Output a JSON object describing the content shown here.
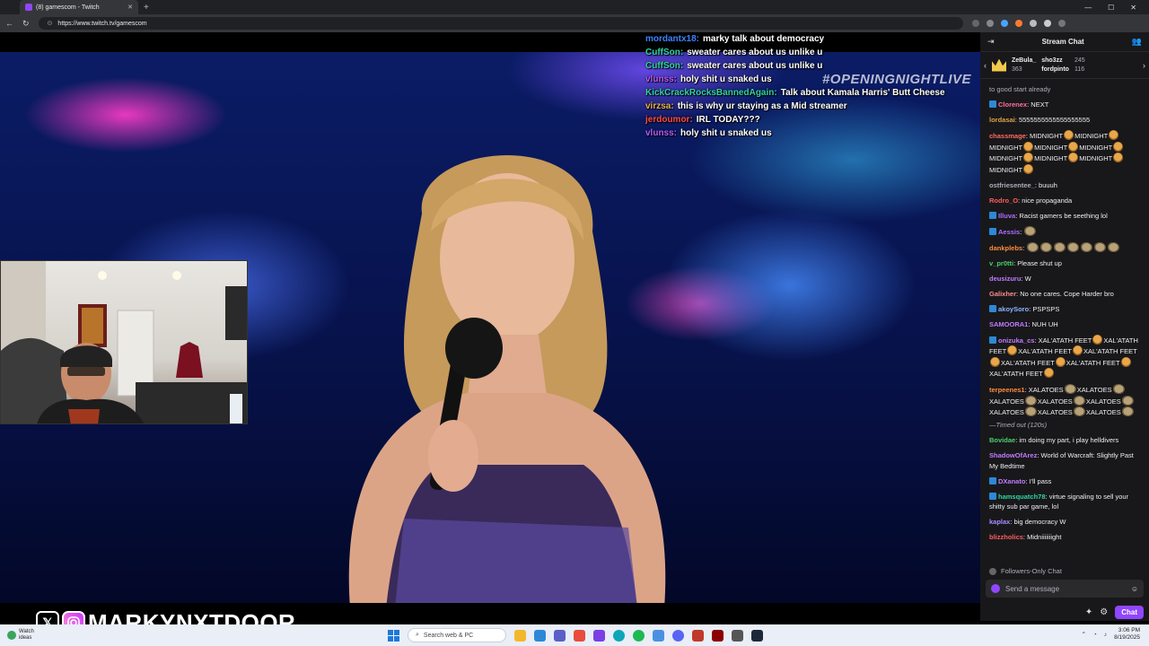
{
  "browser": {
    "tab_title": "(8) gamescom - Twitch",
    "url": "https://www.twitch.tv/gamescom"
  },
  "stream": {
    "hashtag": "#OPENINGNIGHTLIVE",
    "watermark": "MARKYNXTDOOR"
  },
  "overlay_chat": [
    {
      "user": "mordantx18:",
      "color": "#3b82ff",
      "text": "marky talk about democracy"
    },
    {
      "user": "CuffSon:",
      "color": "#2fd4a0",
      "text": "sweater cares about us unlike u"
    },
    {
      "user": "CuffSon:",
      "color": "#2fd4a0",
      "text": "sweater cares about us unlike u"
    },
    {
      "user": "vlunss:",
      "color": "#b45cff",
      "text": "holy shit u snaked us"
    },
    {
      "user": "KickCrackRocksBannedAgain:",
      "color": "#2fd4a0",
      "text": "Talk about Kamala Harris' Butt Cheese"
    },
    {
      "user": "virzsa:",
      "color": "#e8b04a",
      "text": "this is why ur staying as a Mid streamer"
    },
    {
      "user": "jerdoumor:",
      "color": "#ff4a4a",
      "text": "IRL TODAY???"
    },
    {
      "user": "vlunss:",
      "color": "#b45cff",
      "text": "holy shit u snaked us"
    }
  ],
  "chat": {
    "title": "Stream Chat",
    "leaderboard": [
      {
        "name": "ZeBula_",
        "count": "363"
      },
      {
        "name": "sho3zz",
        "count": "245"
      },
      {
        "name": "fordpinto",
        "count": "116"
      }
    ],
    "messages": [
      {
        "user": "",
        "color": "#adadb8",
        "text": "to good start already"
      },
      {
        "user": "Clorenex",
        "color": "#ff6f9c",
        "text": "NEXT",
        "badge": true
      },
      {
        "user": "lordasai",
        "color": "#e0a04a",
        "text": "5555555555555555555"
      },
      {
        "user": "chassmage",
        "color": "#ff6a5e",
        "text": "MIDNIGHT",
        "emotes": "midnight"
      },
      {
        "user": "ostfriesentee_",
        "color": "#adadb8",
        "text": "buuuh"
      },
      {
        "user": "Rodro_O",
        "color": "#ff5c5c",
        "text": "nice propaganda"
      },
      {
        "user": "Illuva",
        "color": "#b06cff",
        "text": "Racist gamers be seething lol",
        "badge": true
      },
      {
        "user": "Aessis",
        "color": "#b06cff",
        "text": "",
        "badge": true
      },
      {
        "user": "dankplebs",
        "color": "#ff8c3a",
        "text": "",
        "emotes": "beans"
      },
      {
        "user": "v_pr0tti",
        "color": "#4ad06a",
        "text": "Please shut up"
      },
      {
        "user": "deusizuru",
        "color": "#c07cff",
        "text": "W"
      },
      {
        "user": "Galixher",
        "color": "#ff8c8c",
        "text": "No one cares. Cope Harder bro"
      },
      {
        "user": "akoySoro",
        "color": "#8ab4ff",
        "text": "PSPSPS",
        "badge": true
      },
      {
        "user": "SAMOORA1",
        "color": "#c07cff",
        "text": "NUH UH"
      },
      {
        "user": "onizuka_cs",
        "color": "#c07cff",
        "text": "XAL'ATATH FEET",
        "emotes": "xal",
        "badge": true
      },
      {
        "user": "terpeenes1",
        "color": "#ff8c3a",
        "text": "XALATOES",
        "emotes": "xalatoes"
      },
      {
        "user": "Bovidae",
        "color": "#4ad06a",
        "text": "im doing my part, i play helldivers"
      },
      {
        "user": "ShadowOfArez",
        "color": "#c07cff",
        "text": "World of Warcraft: Slightly Past My Bedtime"
      },
      {
        "user": "DXanato",
        "color": "#c07cff",
        "text": "I'll pass",
        "badge": true
      },
      {
        "user": "hamsquatch78",
        "color": "#2fd4a0",
        "text": "virtue signaling to sell your shitty sub par game, lol",
        "badge": true
      },
      {
        "user": "kaplax",
        "color": "#a98cff",
        "text": "big democracy W"
      },
      {
        "user": "blizzholics",
        "color": "#ff5c5c",
        "text": "Midniiiiiiight"
      }
    ],
    "midnight_text": "MIDNIGHT",
    "xal_text": "XAL'ATATH FEET",
    "xalatoes_text": "XALATOES",
    "timed_out": "—Timed out (120s)",
    "followers_only": "Followers-Only Chat",
    "input_placeholder": "Send a message",
    "chat_button": "Chat"
  },
  "taskbar": {
    "weather_temp": "Watch",
    "weather_desc": "ideas",
    "search_placeholder": "Search web & PC",
    "time": "3:06 PM",
    "date": "8/19/2025"
  }
}
